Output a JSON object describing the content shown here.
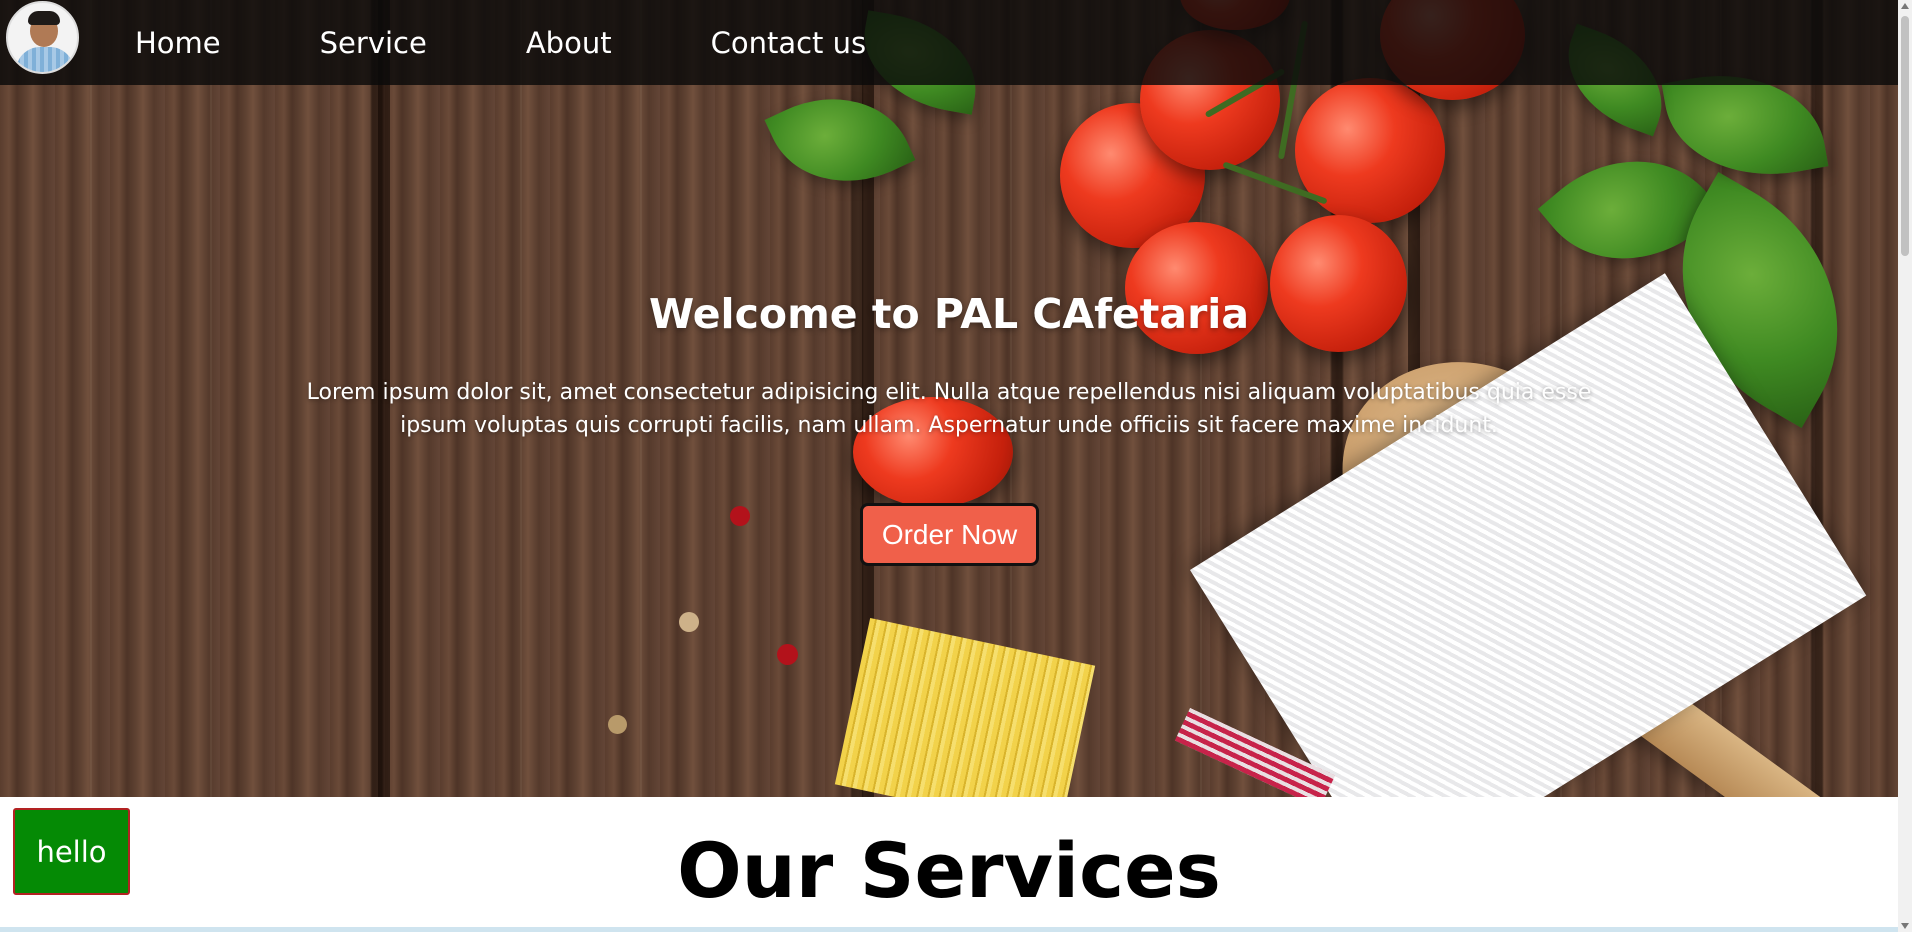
{
  "nav": {
    "avatar_icon": "profile-photo",
    "links": [
      {
        "label": "Home"
      },
      {
        "label": "Service"
      },
      {
        "label": "About"
      },
      {
        "label": "Contact us"
      }
    ]
  },
  "hero": {
    "title": "Welcome to PAL CAfetaria",
    "text": "Lorem ipsum dolor sit, amet consectetur adipisicing elit. Nulla atque repellendus nisi aliquam voluptatibus quia esse ipsum voluptas quis corrupti facilis, nam ullam. Aspernatur unde officiis sit facere maxime incidunt.",
    "button_label": "Order Now",
    "button_color": "#f0604a"
  },
  "services": {
    "hello_button_label": "hello",
    "hello_button_color": "#058a05",
    "title": "Our Services"
  }
}
